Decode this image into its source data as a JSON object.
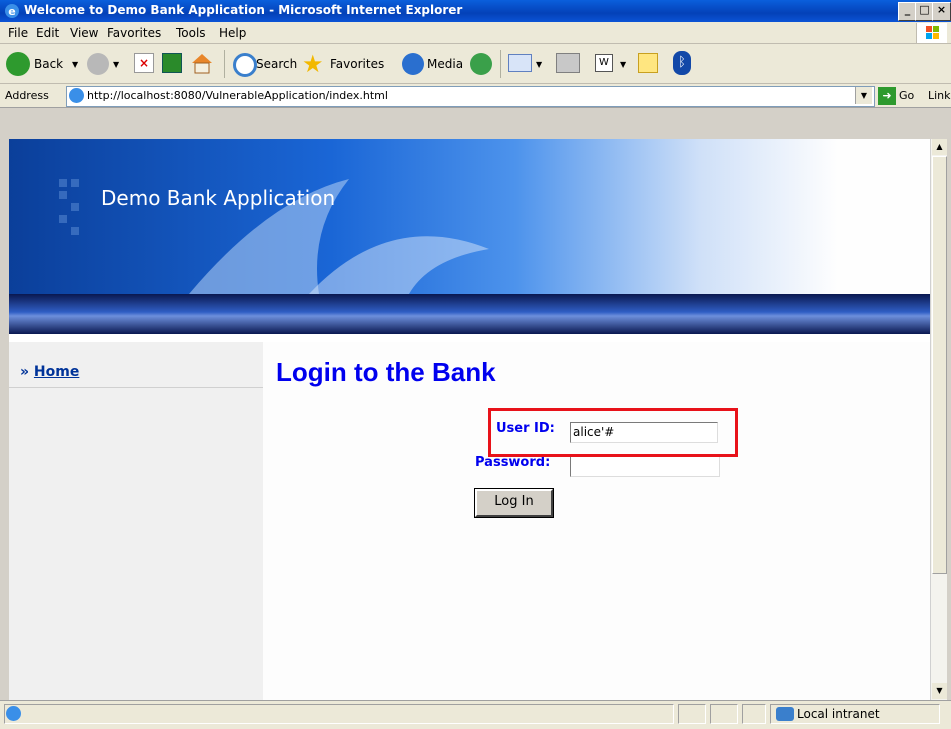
{
  "window": {
    "title": "Welcome to Demo Bank Application - Microsoft Internet Explorer"
  },
  "menu": [
    "File",
    "Edit",
    "View",
    "Favorites",
    "Tools",
    "Help"
  ],
  "toolbar": {
    "back_label": "Back",
    "search_label": "Search",
    "favorites_label": "Favorites",
    "media_label": "Media"
  },
  "address": {
    "label": "Address",
    "url": "http://localhost:8080/VulnerableApplication/index.html",
    "go_label": "Go",
    "links_label": "Links"
  },
  "page": {
    "banner_title": "Demo Bank Application",
    "nav": {
      "arrow": "»",
      "home": "Home"
    },
    "heading": "Login to the Bank",
    "userid_label": "User ID:",
    "userid_value": "alice'#",
    "password_label": "Password:",
    "password_value": "",
    "login_button": "Log In"
  },
  "status": {
    "zone": "Local intranet"
  },
  "colors": {
    "link": "#003399",
    "heading": "#0000ee",
    "highlight": "#e8121a"
  }
}
